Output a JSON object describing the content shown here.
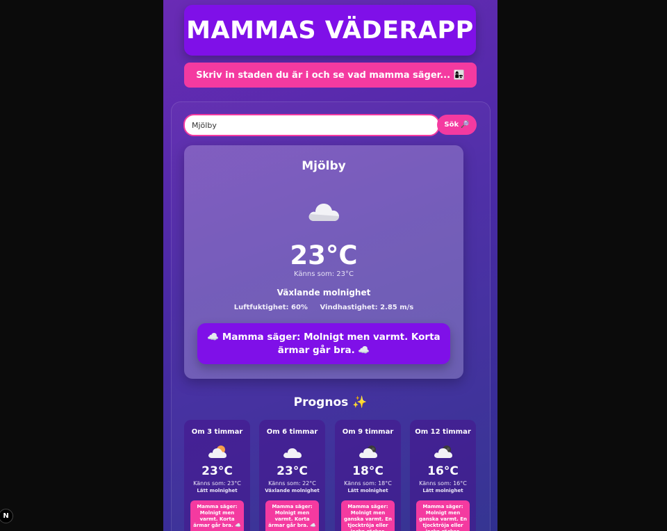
{
  "app": {
    "title": "MAMMAS VÄDERAPP",
    "tagline": "Skriv in staden du är i och se vad mamma säger... 👩‍👧"
  },
  "search": {
    "value": "Mjölby",
    "button_label": "Sök",
    "button_icon": "🔎"
  },
  "current": {
    "city": "Mjölby",
    "icon": "cloud-icon",
    "temp": "23°C",
    "feels_like": "Känns som: 23°C",
    "condition": "Växlande molnighet",
    "humidity": "Luftfuktighet: 60%",
    "wind": "Vindhastighet: 2.85 m/s",
    "mamma": "☁️ Mamma säger: Molnigt men varmt. Korta ärmar går bra. ☁️"
  },
  "forecast_title": "Prognos ✨",
  "forecast": [
    {
      "label": "Om 3 timmar",
      "icon": "sun-behind-cloud-icon",
      "temp": "23°C",
      "feels": "Känns som: 23°C",
      "desc": "Lätt molnighet",
      "mamma": "Mamma säger: Molnigt men varmt. Korta ärmar går bra. ☁️"
    },
    {
      "label": "Om 6 timmar",
      "icon": "cloud-icon",
      "temp": "23°C",
      "feels": "Känns som: 22°C",
      "desc": "Växlande molnighet",
      "mamma": "Mamma säger: Molnigt men varmt. Korta ärmar går bra. ☁️"
    },
    {
      "label": "Om 9 timmar",
      "icon": "moon-behind-cloud-icon",
      "temp": "18°C",
      "feels": "Känns som: 18°C",
      "desc": "Lätt molnighet",
      "mamma": "Mamma säger: Molnigt men ganska varmt. En tjocktröja eller jacka räcker."
    },
    {
      "label": "Om 12 timmar",
      "icon": "moon-behind-cloud-icon",
      "temp": "16°C",
      "feels": "Känns som: 16°C",
      "desc": "Lätt molnighet",
      "mamma": "Mamma säger: Molnigt men ganska varmt. En tjocktröja eller jacka räcker."
    }
  ],
  "badge": "N",
  "colors": {
    "purple": "#7f10e8",
    "pink": "#f43aa0",
    "background": "#0b0b0b"
  }
}
